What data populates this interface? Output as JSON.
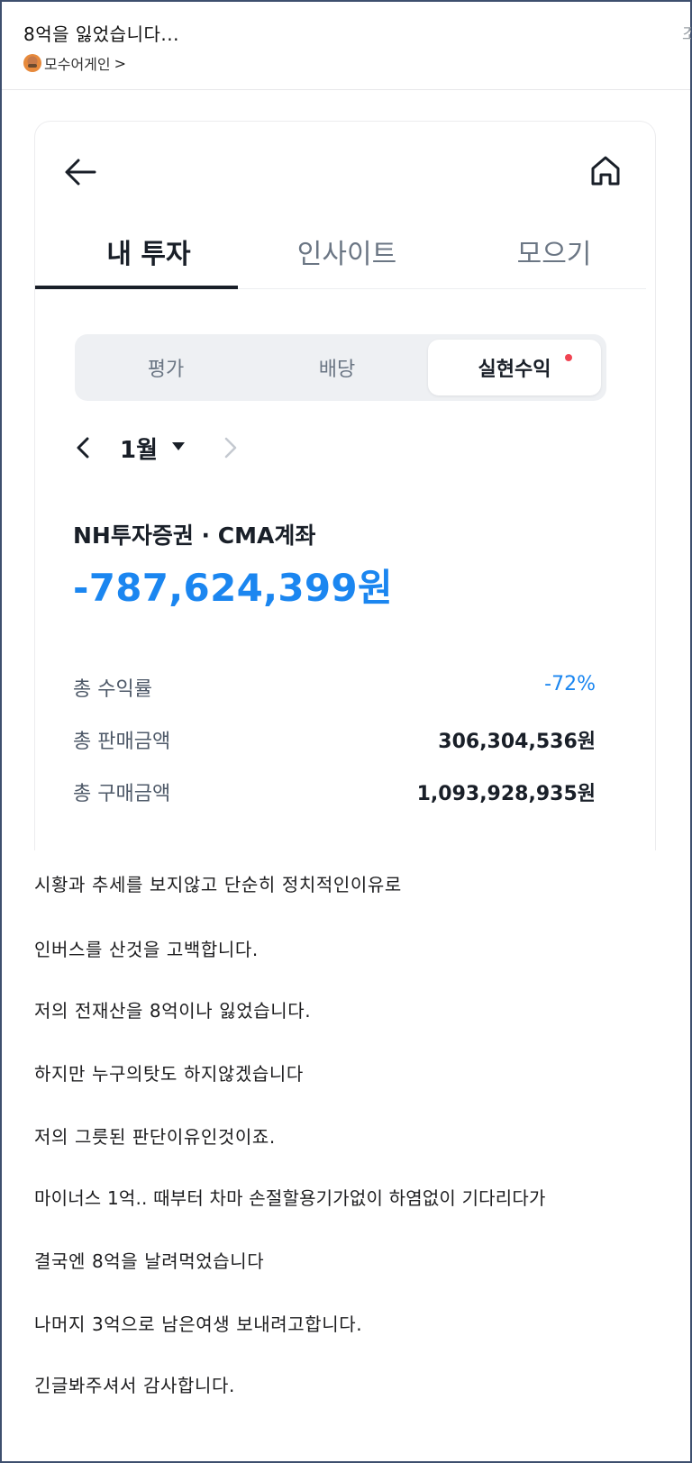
{
  "post": {
    "title": "8억을 잃었습니다...",
    "truncated_edge_text": "조",
    "author": "모수어게인",
    "author_chevron": ">"
  },
  "app": {
    "tabs": [
      "내 투자",
      "인사이트",
      "모으기"
    ],
    "active_tab": "내 투자",
    "segments": [
      "평가",
      "배당",
      "실현수익"
    ],
    "active_segment": "실현수익",
    "month_label": "1월",
    "account_name": "NH투자증권 · CMA계좌",
    "realized_amount": "-787,624,399원",
    "stats": [
      {
        "label": "총 수익률",
        "value": "-72%"
      },
      {
        "label": "총 판매금액",
        "value": "306,304,536원"
      },
      {
        "label": "총 구매금액",
        "value": "1,093,928,935원"
      }
    ],
    "colors": {
      "accent_blue": "#1b86f0",
      "notification_red": "#f04452"
    },
    "icons": [
      "back-arrow-icon",
      "home-icon",
      "chevron-left-icon",
      "caret-down-icon",
      "chevron-right-icon"
    ]
  },
  "body_lines": [
    "시황과 추세를 보지않고 단순히 정치적인이유로",
    "인버스를 산것을 고백합니다.",
    "저의 전재산을 8억이나 잃었습니다.",
    "하지만 누구의탓도 하지않겠습니다",
    "저의 그릇된 판단이유인것이죠.",
    "마이너스 1억..  때부터 차마 손절할용기가없이 하염없이 기다리다가",
    "결국엔 8억을 날려먹었습니다",
    "나머지 3억으로 남은여생 보내려고합니다.",
    "긴글봐주셔서 감사합니다."
  ]
}
